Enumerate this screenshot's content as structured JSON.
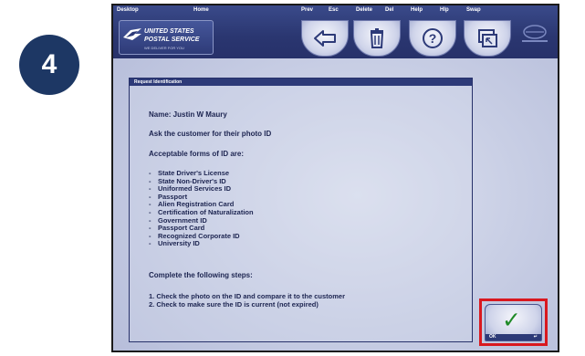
{
  "step": {
    "number": "4"
  },
  "toolbar": {
    "desktop_label": "Desktop",
    "home_label": "Home",
    "prev_label": "Prev",
    "prev_key": "Esc",
    "delete_label": "Delete",
    "delete_key": "Del",
    "help_label": "Help",
    "help_key": "Hlp",
    "swap_label": "Swap",
    "logo_line1": "UNITED STATES",
    "logo_line2": "POSTAL SERVICE",
    "logo_tagline": "WE DELIVER FOR YOU",
    "icons": {
      "prev": "left-arrow-icon",
      "delete": "trash-icon",
      "help": "question-icon",
      "swap": "swap-window-icon"
    }
  },
  "panel": {
    "header": "Request Identification",
    "name_line": "Name: Justin W Maury",
    "ask_line": "Ask the customer for their photo ID",
    "acceptable_heading": "Acceptable forms of ID are:",
    "id_types": [
      "State Driver's License",
      "State Non-Driver's ID",
      "Uniformed Services ID",
      "Passport",
      "Alien Registration Card",
      "Certification of Naturalization",
      "Government ID",
      "Passport Card",
      "Recognized Corporate ID",
      "University ID"
    ],
    "steps_heading": "Complete the following steps:",
    "steps": [
      "1. Check the photo on the ID and compare it to the customer",
      "2. Check to make sure the ID is current (not expired)"
    ]
  },
  "ok_button": {
    "label": "OK",
    "key": "↵",
    "icon": "checkmark-icon"
  },
  "colors": {
    "badge": "#1d3764",
    "toolbar": "#2a3670",
    "highlight": "#d9181f",
    "check": "#1f8a28"
  }
}
